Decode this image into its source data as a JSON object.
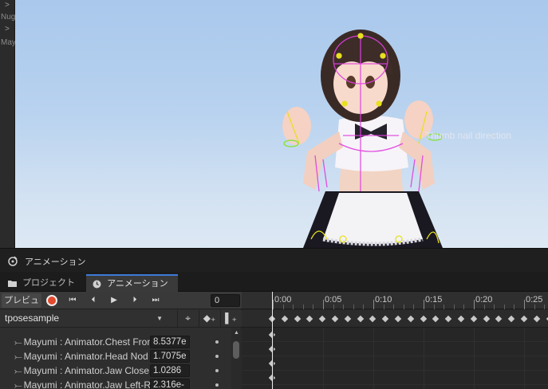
{
  "scene": {
    "hierarchy_rows": [
      {
        "chevron": ">",
        "cut_text": ""
      },
      {
        "chevron": ">",
        "cut_text": "Nug"
      },
      {
        "chevron": ">",
        "cut_text": ""
      },
      {
        "chevron": "",
        "cut_text": "May"
      }
    ],
    "overlay_label": "Thumb nail direction"
  },
  "window": {
    "title": "アニメーション",
    "tabs": [
      {
        "label": "プロジェクト",
        "icon": "folder-icon",
        "active": false
      },
      {
        "label": "アニメーション",
        "icon": "clock-icon",
        "active": true
      }
    ]
  },
  "controls": {
    "preview_label": "プレビュー",
    "record_icon": "record-icon",
    "first_key_icon": "⏮",
    "prev_key_icon": "⏴",
    "play_icon": "▶",
    "next_key_icon": "⏵",
    "last_key_icon": "⏭",
    "frame_value": "0",
    "record_color": "#e34b2e"
  },
  "clip": {
    "name": "tposesample",
    "tools": [
      {
        "icon": "filter-keys-icon",
        "glyph": "⌖"
      },
      {
        "icon": "add-keyframe-icon",
        "glyph": "◆₊"
      },
      {
        "icon": "add-event-icon",
        "glyph": "▌₊"
      }
    ]
  },
  "properties": [
    {
      "name": "Mayumi : Animator.Chest Front-Back",
      "value": "8.5377e"
    },
    {
      "name": "Mayumi : Animator.Head Nod Down-Up",
      "value": "1.7075e"
    },
    {
      "name": "Mayumi : Animator.Jaw Close",
      "value": "1.0286"
    },
    {
      "name": "Mayumi : Animator.Jaw Left-Right",
      "value": "2.316e-"
    }
  ],
  "timeline": {
    "tick_labels": [
      "0:00",
      "0:05",
      "0:10",
      "0:15",
      "0:20",
      "0:25"
    ],
    "summary_keyframe_count": 23,
    "playhead_frame": 0
  },
  "colors": {
    "accent": "#3d7bd6",
    "playhead": "#e8e8e8"
  }
}
